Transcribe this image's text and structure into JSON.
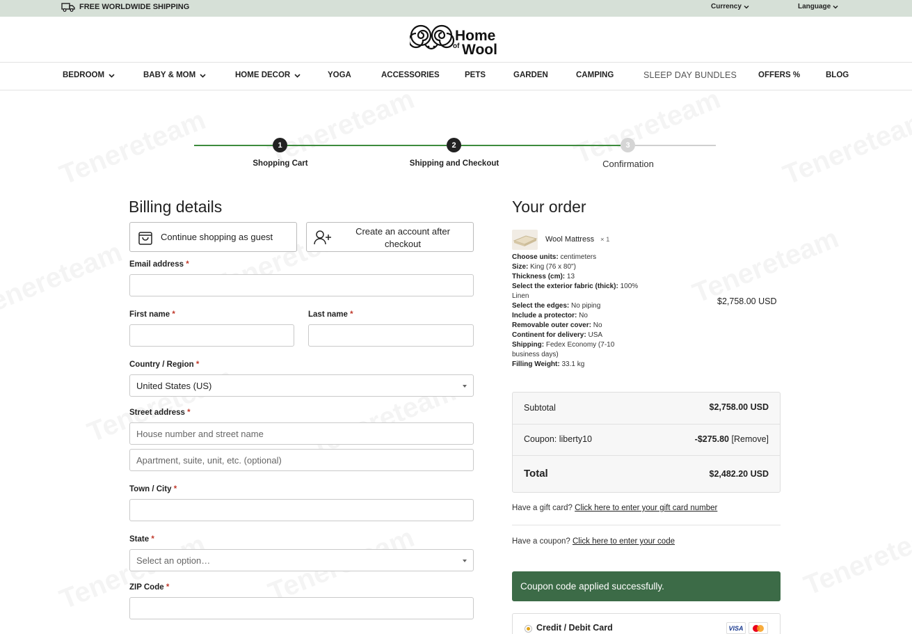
{
  "topbar": {
    "shipping_text": "FREE WORLDWIDE SHIPPING",
    "currency_label": "Currency",
    "language_label": "Language"
  },
  "header": {
    "logo_text_1": "Home",
    "logo_text_2": "of",
    "logo_text_3": "Wool"
  },
  "nav": {
    "items": [
      {
        "label": "BEDROOM"
      },
      {
        "label": "BABY & MOM"
      },
      {
        "label": "HOME DECOR"
      },
      {
        "label": "YOGA"
      },
      {
        "label": "ACCESSORIES"
      },
      {
        "label": "PETS"
      },
      {
        "label": "GARDEN"
      },
      {
        "label": "CAMPING"
      },
      {
        "label": "SLEEP DAY BUNDLES"
      },
      {
        "label": "OFFERS %"
      },
      {
        "label": "BLOG"
      }
    ]
  },
  "stepper": {
    "steps": [
      {
        "number": "1",
        "label": "Shopping Cart"
      },
      {
        "number": "2",
        "label": "Shipping and Checkout"
      },
      {
        "number": "3",
        "label": "Confirmation"
      }
    ]
  },
  "billing": {
    "title": "Billing details",
    "guest_button": "Continue shopping as guest",
    "account_button": "Create an account after checkout",
    "email_label": "Email address",
    "first_name_label": "First name",
    "last_name_label": "Last name",
    "country_label": "Country / Region",
    "country_value": "United States (US)",
    "street_label": "Street address",
    "street_placeholder": "House number and street name",
    "apt_placeholder": "Apartment, suite, unit, etc. (optional)",
    "city_label": "Town / City",
    "state_label": "State",
    "state_placeholder": "Select an option…",
    "zip_label": "ZIP Code",
    "required_mark": "*"
  },
  "order": {
    "title": "Your order",
    "product_name": "Wool Mattress",
    "product_qty": "× 1",
    "line_total": "$2,758.00 USD",
    "meta": [
      {
        "k": "Choose units:",
        "v": "centimeters"
      },
      {
        "k": "Size:",
        "v": "King (76 x 80\")"
      },
      {
        "k": "Thickness (cm):",
        "v": "13"
      },
      {
        "k": "Select the exterior fabric (thick):",
        "v": "100%"
      },
      {
        "k": "",
        "v": "Linen"
      },
      {
        "k": "Select the edges:",
        "v": "No piping"
      },
      {
        "k": "Include a protector:",
        "v": "No"
      },
      {
        "k": "Removable outer cover:",
        "v": "No"
      },
      {
        "k": "Continent for delivery:",
        "v": "USA"
      },
      {
        "k": "Shipping:",
        "v": "Fedex Economy (7-10"
      },
      {
        "k": "",
        "v": "business days)"
      },
      {
        "k": "Filling Weight:",
        "v": "33.1 kg"
      }
    ],
    "subtotal_label": "Subtotal",
    "subtotal_value": "$2,758.00 USD",
    "coupon_label": "Coupon: liberty10",
    "coupon_value": "-$275.80",
    "coupon_remove": "[Remove]",
    "total_label": "Total",
    "total_value": "$2,482.20 USD",
    "gift_prompt": "Have a gift card?",
    "gift_link": "Click here to enter your gift card number",
    "coupon_prompt": "Have a coupon?",
    "coupon_link": "Click here to enter your code",
    "success_message": "Coupon code applied successfully.",
    "payment_label": "Credit / Debit Card",
    "card_visa": "VISA"
  },
  "watermark": "Tenereteam",
  "colors": {
    "topbar_bg": "#d6e0d7",
    "step_active": "#3d8b3d",
    "step_dot_dark": "#222222",
    "step_dot_inactive": "#cccccc",
    "success_bg": "#3c6b47",
    "required": "#c0392b"
  }
}
